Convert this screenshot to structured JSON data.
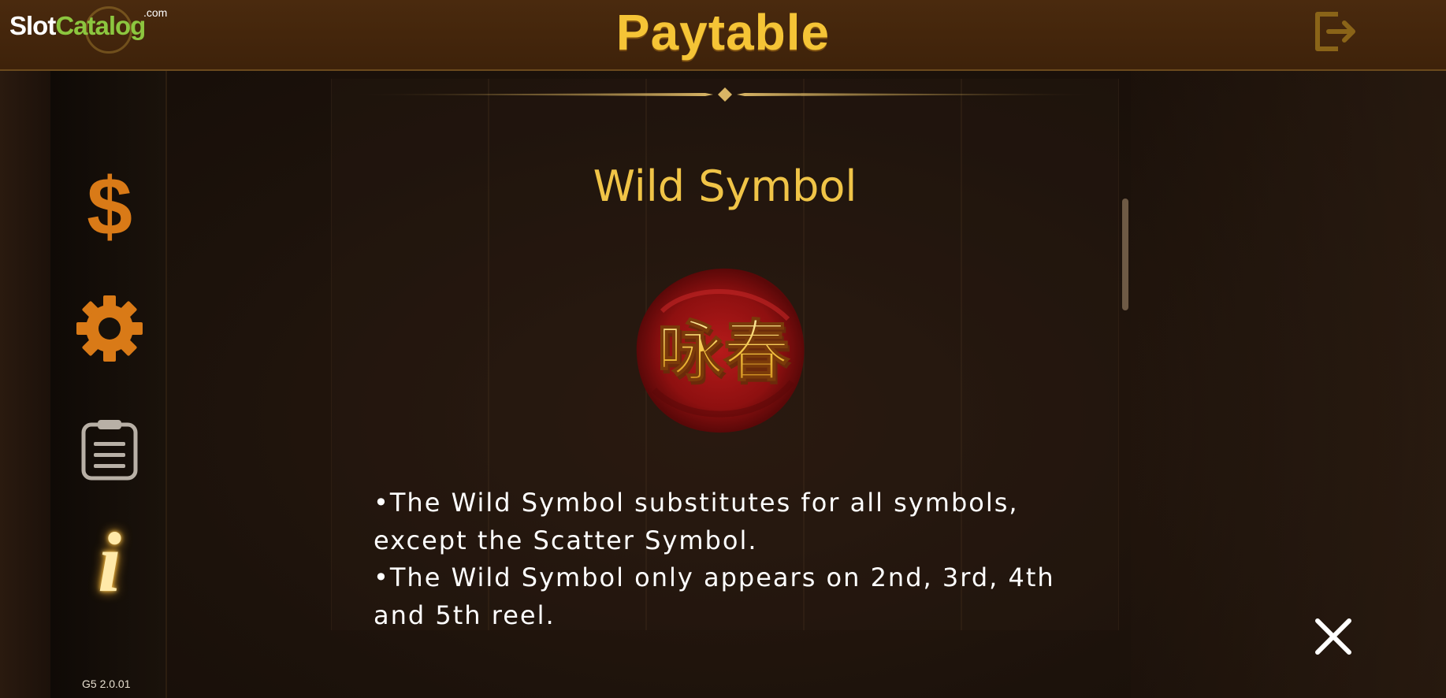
{
  "header": {
    "title": "Paytable",
    "logo": {
      "slot": "Slot",
      "catalog": "Catalog",
      "com": ".com"
    }
  },
  "section": {
    "title": "Wild Symbol",
    "wild_symbol_text": "咏春",
    "description": [
      "•The Wild Symbol substitutes for all symbols,",
      "except the Scatter Symbol.",
      "•The Wild Symbol only appears on 2nd, 3rd, 4th",
      "and 5th reel."
    ]
  },
  "sidebar": {
    "items": [
      {
        "name": "bet",
        "icon": "dollar-icon",
        "glyph": "$"
      },
      {
        "name": "settings",
        "icon": "gear-icon"
      },
      {
        "name": "history",
        "icon": "clipboard-icon"
      },
      {
        "name": "info",
        "icon": "info-icon",
        "glyph": "i"
      }
    ],
    "version": "G5 2.0.01"
  },
  "colors": {
    "header_bg": "#3e220a",
    "title_gold": "#f5c436",
    "accent_orange": "#d97a17",
    "section_title": "#f0c447",
    "seal_red": "#9e1515",
    "text": "#ffffff"
  }
}
